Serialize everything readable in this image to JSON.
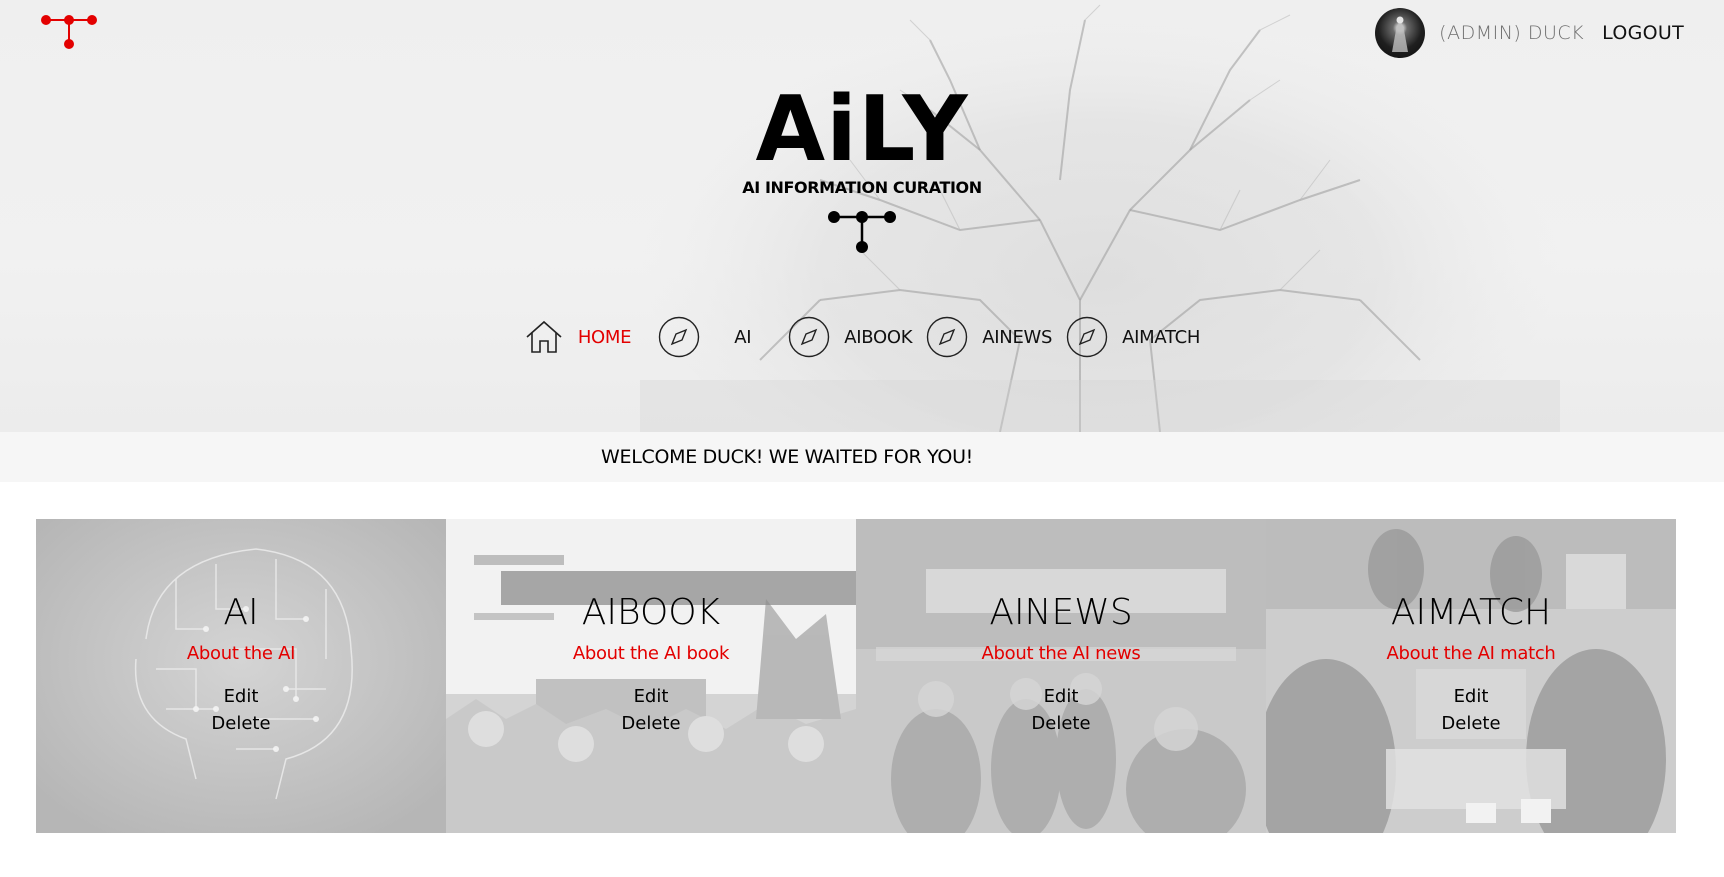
{
  "brand": {
    "title": "AiLY",
    "subtitle": "AI INFORMATION CURATION",
    "accent_color": "#e30000"
  },
  "header": {
    "user_label": "(ADMIN) DUCK",
    "logout_label": "LOGOUT"
  },
  "nav": {
    "items": [
      {
        "label": "HOME",
        "icon": "home-icon",
        "active": true
      },
      {
        "label": "AI",
        "icon": "compass-icon",
        "active": false
      },
      {
        "label": "AIBOOK",
        "icon": "compass-icon",
        "active": false
      },
      {
        "label": "AINEWS",
        "icon": "compass-icon",
        "active": false
      },
      {
        "label": "AIMATCH",
        "icon": "compass-icon",
        "active": false
      }
    ]
  },
  "welcome": {
    "text": "WELCOME DUCK! WE WAITED FOR YOU!"
  },
  "cards": [
    {
      "title": "AI",
      "description": "About the AI",
      "edit_label": "Edit",
      "delete_label": "Delete",
      "image": "circuit-brain-image"
    },
    {
      "title": "AIBOOK",
      "description": "About the AI book",
      "edit_label": "Edit",
      "delete_label": "Delete",
      "image": "book-cover-image"
    },
    {
      "title": "AINEWS",
      "description": "About the AI news",
      "edit_label": "Edit",
      "delete_label": "Delete",
      "image": "news-event-image"
    },
    {
      "title": "AIMATCH",
      "description": "About the AI match",
      "edit_label": "Edit",
      "delete_label": "Delete",
      "image": "match-photo-image"
    }
  ]
}
